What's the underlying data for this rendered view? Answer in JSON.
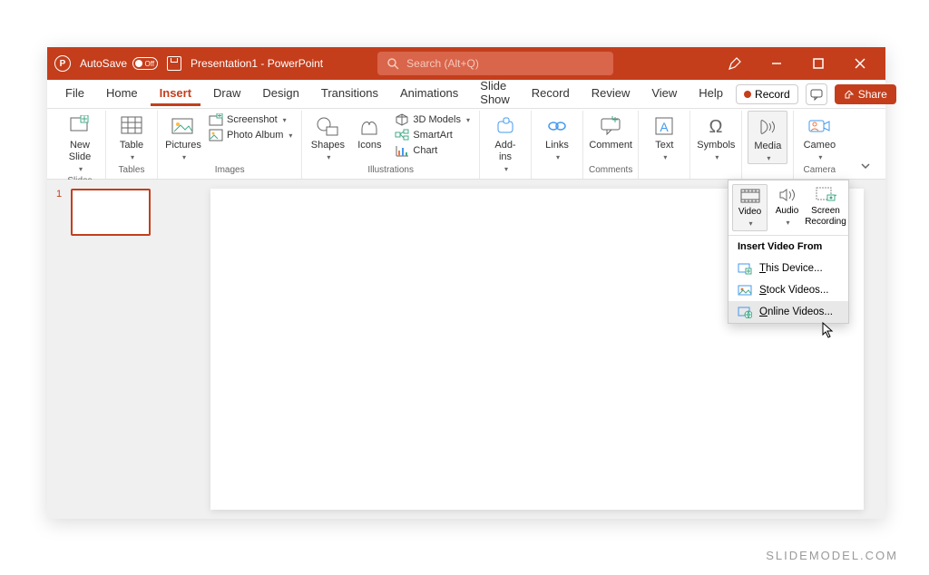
{
  "titlebar": {
    "autosave_label": "AutoSave",
    "autosave_state": "Off",
    "doc_title": "Presentation1 - PowerPoint",
    "search_placeholder": "Search (Alt+Q)"
  },
  "tabs": {
    "items": [
      "File",
      "Home",
      "Insert",
      "Draw",
      "Design",
      "Transitions",
      "Animations",
      "Slide Show",
      "Record",
      "Review",
      "View",
      "Help"
    ],
    "active": "Insert",
    "record_btn": "Record",
    "share_btn": "Share"
  },
  "ribbon": {
    "slides": {
      "label": "Slides",
      "new_slide": "New\nSlide"
    },
    "tables": {
      "label": "Tables",
      "table": "Table"
    },
    "images": {
      "label": "Images",
      "pictures": "Pictures",
      "screenshot": "Screenshot",
      "photo_album": "Photo Album"
    },
    "illustrations": {
      "label": "Illustrations",
      "shapes": "Shapes",
      "icons": "Icons",
      "models3d": "3D Models",
      "smartart": "SmartArt",
      "chart": "Chart"
    },
    "addins": {
      "label": "",
      "addins": "Add-\nins"
    },
    "links": {
      "label": "",
      "links": "Links"
    },
    "comments": {
      "label": "Comments",
      "comment": "Comment"
    },
    "text": {
      "label": "",
      "text": "Text"
    },
    "symbols": {
      "label": "",
      "symbols": "Symbols"
    },
    "media": {
      "label": "",
      "media": "Media"
    },
    "camera": {
      "label": "Camera",
      "cameo": "Cameo"
    }
  },
  "thumbnails": {
    "slide_num": "1"
  },
  "media_popup": {
    "video": "Video",
    "audio": "Audio",
    "screen_recording": "Screen\nRecording",
    "header": "Insert Video From",
    "this_device": "This Device...",
    "stock_videos": "Stock Videos...",
    "online_videos": "Online Videos..."
  },
  "watermark": "SLIDEMODEL.COM"
}
